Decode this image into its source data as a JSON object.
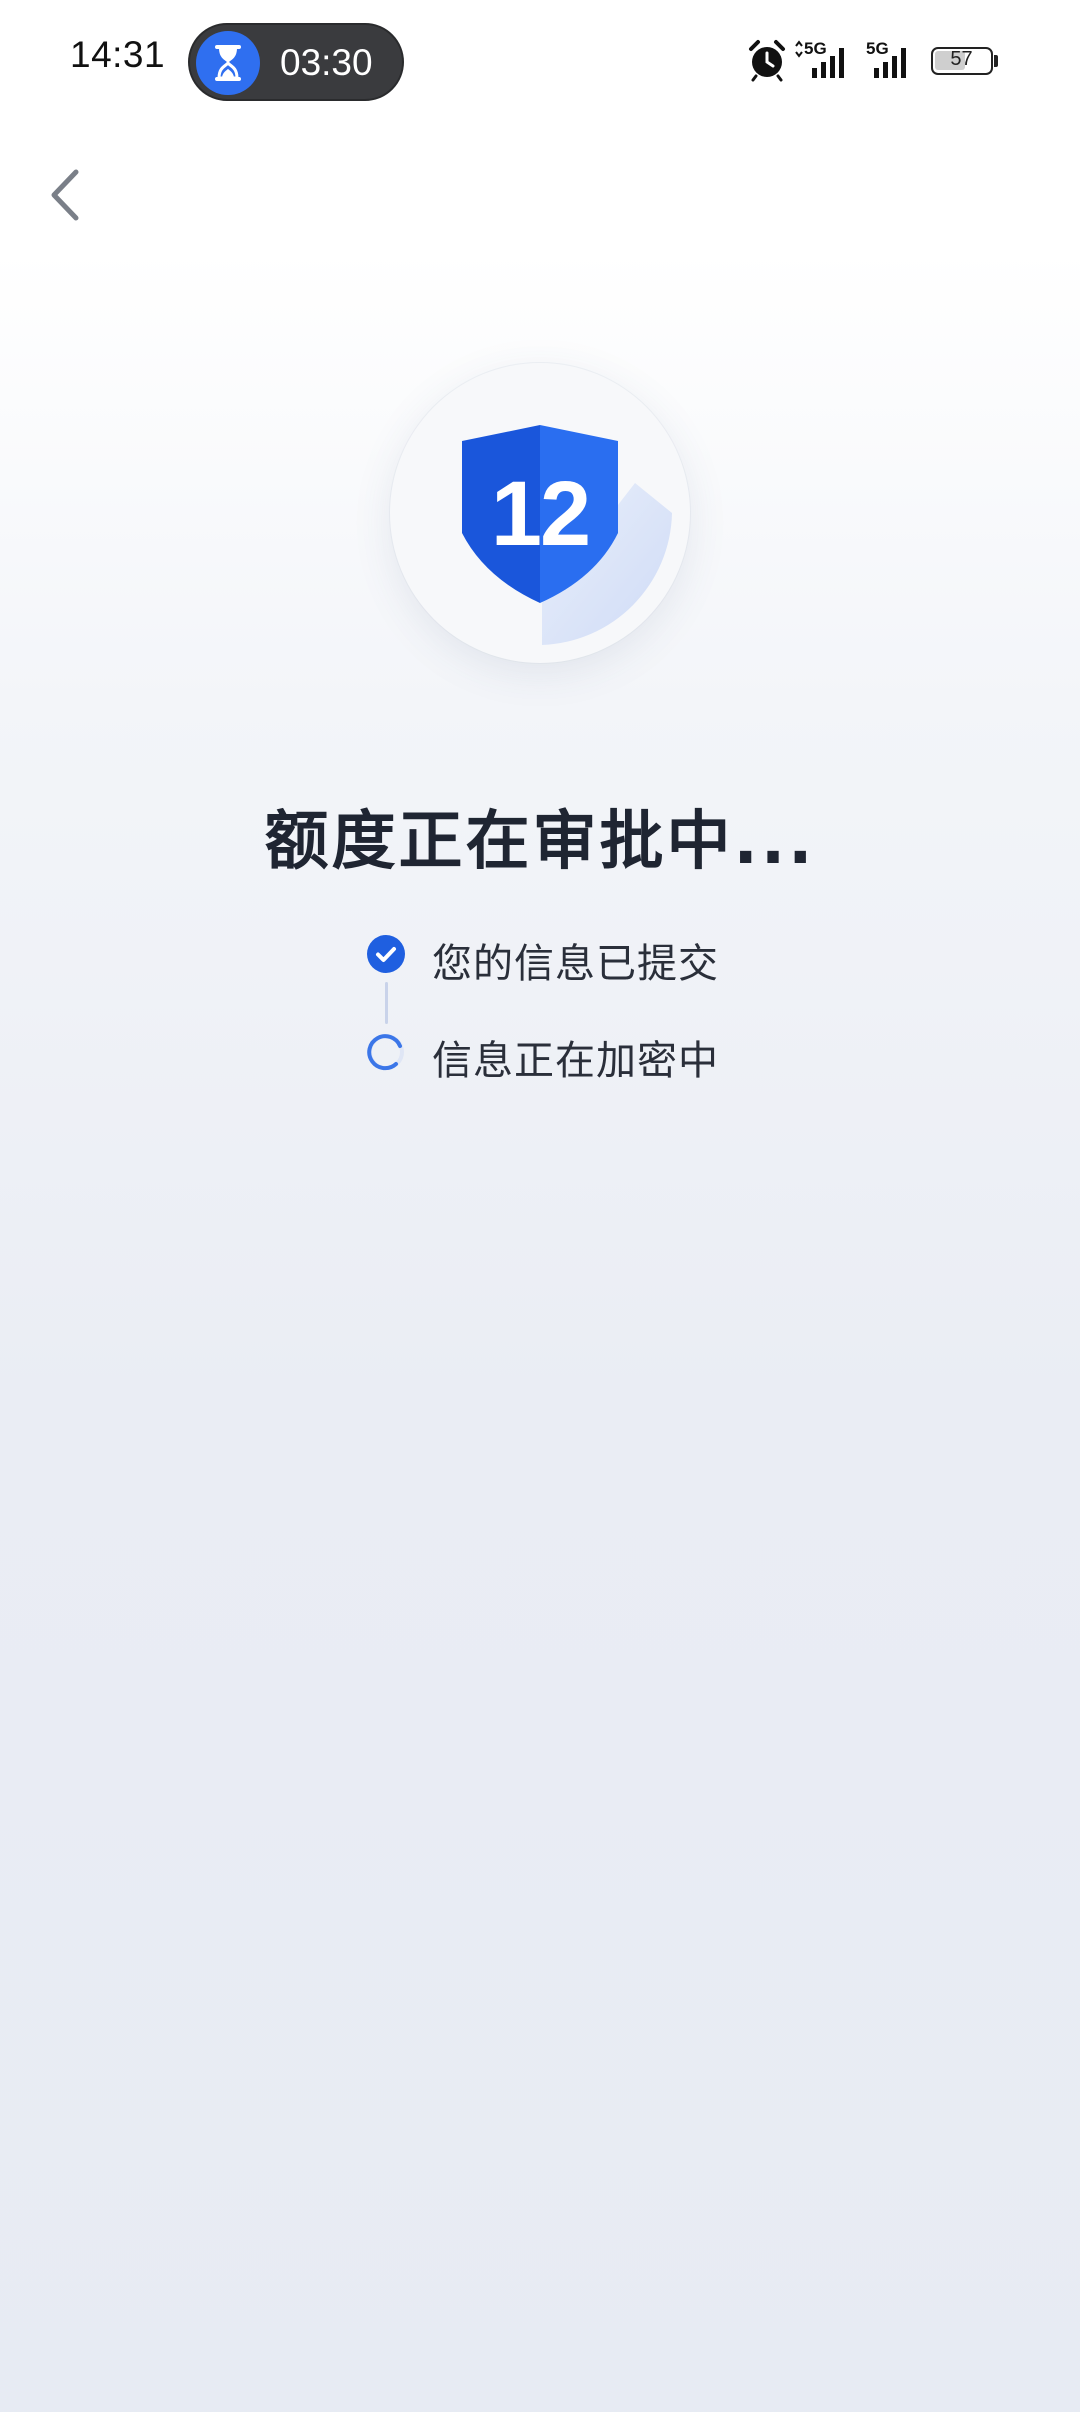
{
  "status_bar": {
    "time": "14:31",
    "timer": "03:30",
    "network_1": "5G",
    "network_2": "5G",
    "battery": "57",
    "battery_level": 0.57
  },
  "header": {
    "back_icon": "chevron-left-icon"
  },
  "logo": {
    "text": "12",
    "icon": "shield-logo-icon",
    "primary_color": "#1a56db",
    "secondary_color": "#2a6ef0"
  },
  "main": {
    "title": "额度正在审批中...",
    "steps": [
      {
        "label": "您的信息已提交",
        "state": "done",
        "icon": "check-circle-icon"
      },
      {
        "label": "信息正在加密中",
        "state": "in-progress",
        "icon": "loading-spinner-icon"
      }
    ]
  },
  "colors": {
    "accent": "#1f5fe0",
    "title": "#1f2532"
  }
}
